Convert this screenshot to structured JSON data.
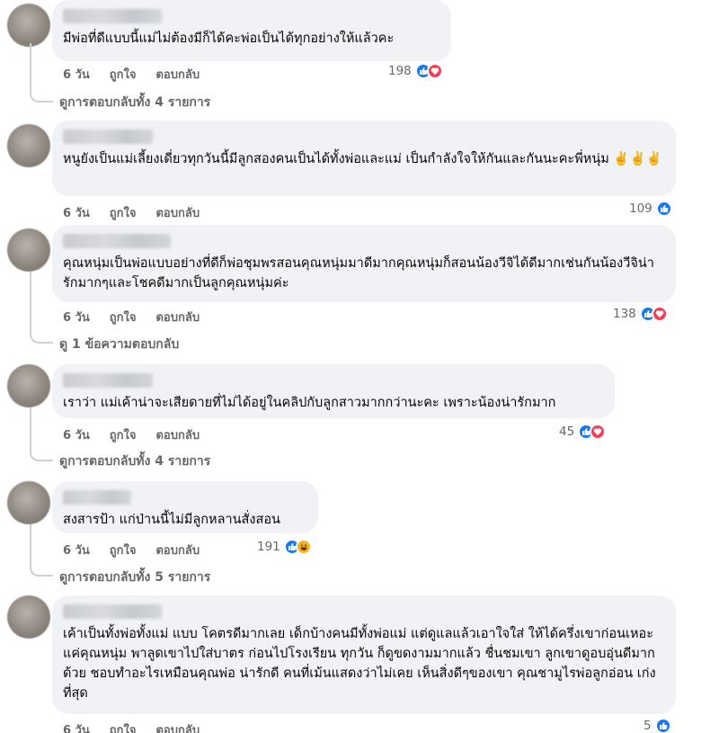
{
  "colors": {
    "like": "#1877f2",
    "love": "#f33e58",
    "haha": "#f7b125",
    "bubble": "#f0f2f5",
    "meta": "#65676b"
  },
  "actions": {
    "time": "6 วัน",
    "like": "ถูกใจ",
    "reply": "ตอบกลับ"
  },
  "comments": [
    {
      "text": "มีพ่อที่ดีแบบนี้แม่ไม่ต้องมีก็ได้คะพ่อเป็นได้ทุกอย่างให้แล้วคะ",
      "reaction_count": "198",
      "reaction_icons": [
        "like-icon",
        "love-icon"
      ],
      "view_replies": "ดูการตอบกลับทั้ง 4 รายการ"
    },
    {
      "text": "หนูยังเป็นแม่เลี้ยงเดี่ยวทุกวันนี้มีลูกสองคนเป็นได้ทั้งพ่อและแม่ เป็นกำลังใจให้กันและกันนะคะพี่หนุ่ม ✌️✌️✌️",
      "reaction_count": "109",
      "reaction_icons": [
        "like-icon"
      ]
    },
    {
      "text": "คุณหนุ่มเป็นพ่อแบบอย่างที่ดีก็พ่อชุมพรสอนคุณหนุ่มมาดีมากคุณหนุ่มก็สอนน้องวีจิได้ดีมากเช่นกันน้องวีจิน่ารักมากๆและโชคดีมากเป็นลูกคุณหนุ่มค่ะ",
      "reaction_count": "138",
      "reaction_icons": [
        "like-icon",
        "love-icon"
      ],
      "view_replies": "ดู 1 ข้อความตอบกลับ"
    },
    {
      "text": "เราว่า แม่เค้าน่าจะเสียดายที่ไม่ได้อยู่ในคลิปกับลูกสาวมากกว่านะคะ เพราะน้องน่ารักมาก",
      "reaction_count": "45",
      "reaction_icons": [
        "like-icon",
        "love-icon"
      ],
      "view_replies": "ดูการตอบกลับทั้ง 4 รายการ"
    },
    {
      "text": "สงสารป้า แก่ป่านนี้ไม่มีลูกหลานสั่งสอน",
      "reaction_count": "191",
      "reaction_icons": [
        "like-icon",
        "haha-icon"
      ],
      "view_replies": "ดูการตอบกลับทั้ง 5 รายการ"
    },
    {
      "text": "เค้าเป็นทั้งพ่อทั้งแม่ แบบ โคตรดีมากเลย เด็กบ้างคนมีทั้งพ่อแม่ แต่ดูแลแล้วเอาใจใส่ ให้ได้ครึ่งเขาก่อนเหอะ แค่คุณหนุ่ม พาลูดเขาไปใส่บาตร ก่อนไปโรงเรียน ทุกวัน ก็ดูขดงามมากแล้ว ชื่นชมเขา ลูกเขาดูอบอุ่นดีมากด้วย ชอบทำอะไรเหมือนคุณพ่อ น่ารักดี คนที่เม้นแสดงว่าไม่เคย เห็นสิ่งดีๆของเขา คุณชามูไรพ่อลูกอ่อน เก่งที่สุด",
      "reaction_count": "5",
      "reaction_icons": [
        "like-icon"
      ]
    }
  ]
}
